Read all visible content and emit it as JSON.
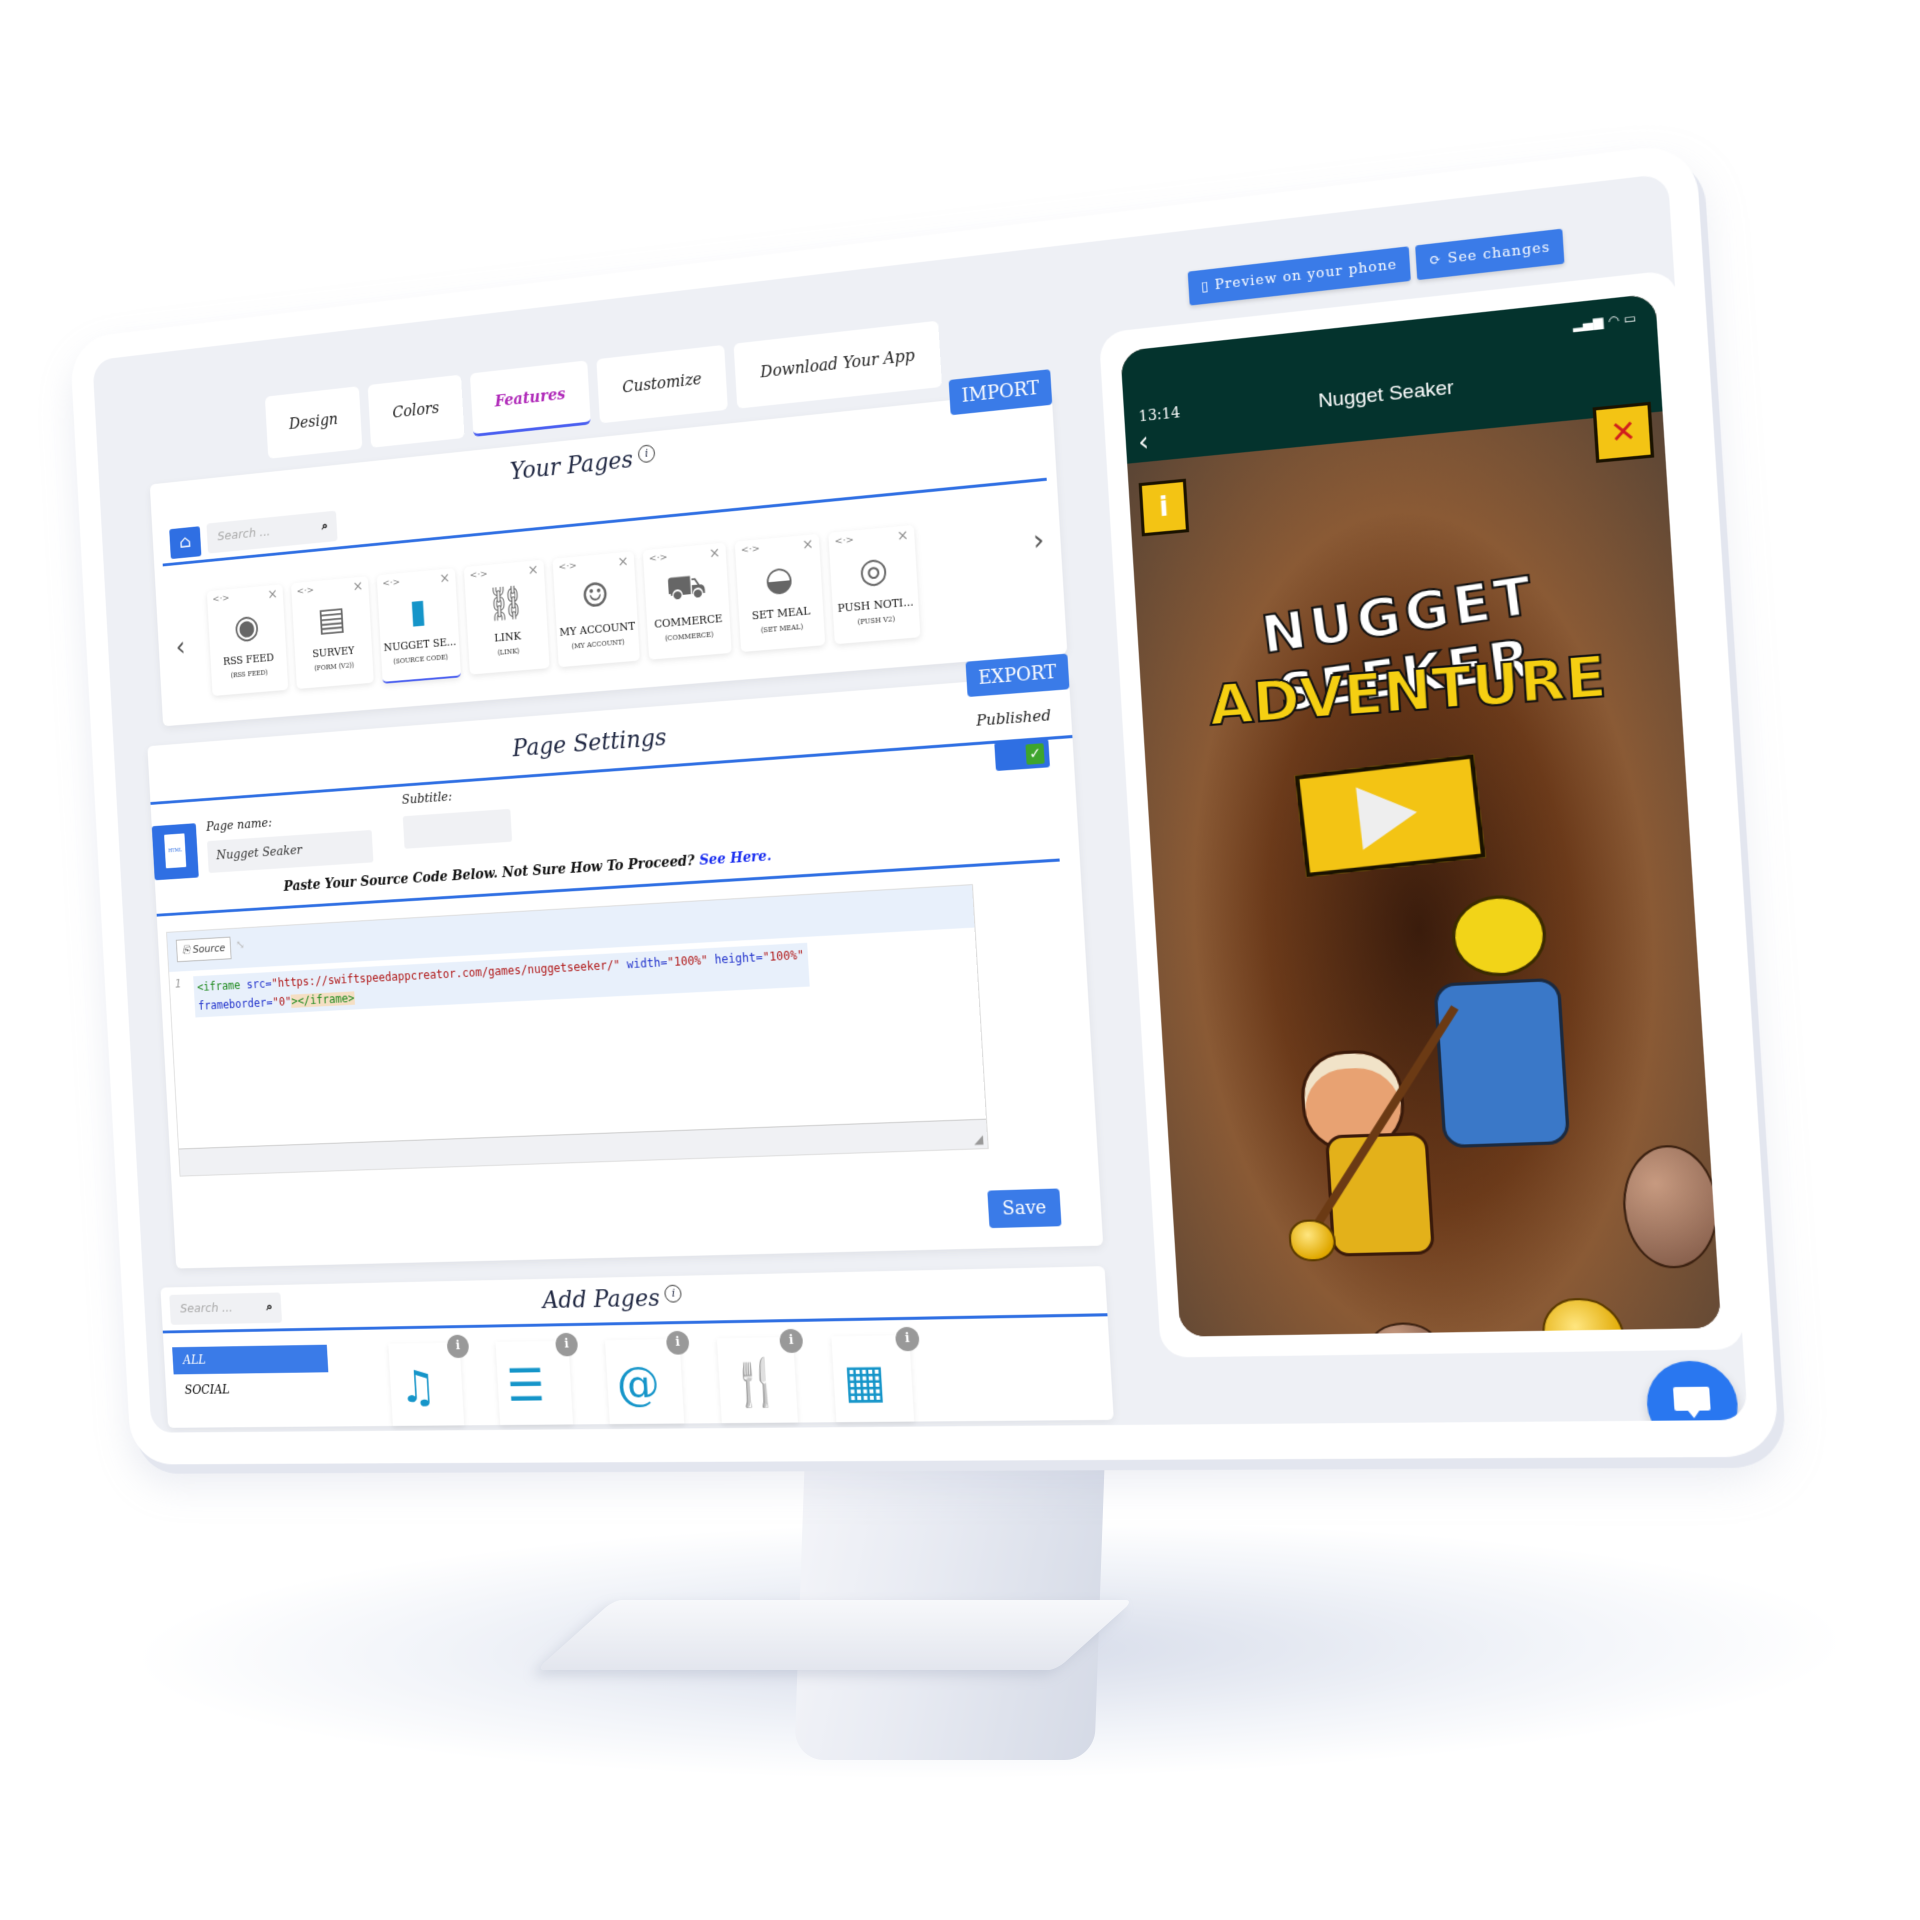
{
  "tabs": [
    {
      "label": "Design"
    },
    {
      "label": "Colors"
    },
    {
      "label": "Features",
      "active": true
    },
    {
      "label": "Customize"
    },
    {
      "label": "Download Your App"
    }
  ],
  "your_pages": {
    "title": "Your Pages",
    "import_label": "IMPORT",
    "search_placeholder": "Search ...",
    "cards": [
      {
        "name": "RSS FEED",
        "type": "(RSS FEED)",
        "icon": "rss-lock-icon"
      },
      {
        "name": "SURVEY",
        "type": "(FORM (V2))",
        "icon": "clipboard-icon"
      },
      {
        "name": "NUGGET SE...",
        "type": "(SOURCE CODE)",
        "icon": "html-file-icon",
        "active": true
      },
      {
        "name": "LINK",
        "type": "(LINK)",
        "icon": "link-lock-icon"
      },
      {
        "name": "MY ACCOUNT",
        "type": "(MY ACCOUNT)",
        "icon": "user-circle-icon"
      },
      {
        "name": "COMMERCE",
        "type": "(COMMERCE)",
        "icon": "cart-icon"
      },
      {
        "name": "SET MEAL",
        "type": "(SET MEAL)",
        "icon": "burger-icon"
      },
      {
        "name": "PUSH NOTI...",
        "type": "(PUSH V2)",
        "icon": "push-icon"
      }
    ]
  },
  "page_settings": {
    "title": "Page Settings",
    "export_label": "EXPORT",
    "published_label": "Published",
    "published": true,
    "page_name_label": "Page name:",
    "page_name_value": "Nugget Seaker",
    "subtitle_label": "Subtitle:",
    "subtitle_value": "",
    "paste_text": "Paste Your Source Code Below. Not Sure How To Proceed?",
    "see_here_label": "See Here."
  },
  "code_editor": {
    "source_label": "Source",
    "line_number": "1",
    "tag_open": "<iframe",
    "attr_src": "src=",
    "val_src": "\"https://swiftspeedappcreator.com/games/nuggetseeker/\"",
    "attr_width": "width=",
    "val_width": "\"100%\"",
    "attr_height": "height=",
    "val_height": "\"100%\"",
    "attr_frameborder": "frameborder=",
    "val_frameborder": "\"0\"",
    "tag_close_bracket": ">",
    "tag_close": "</iframe>"
  },
  "save_label": "Save",
  "add_pages": {
    "title": "Add Pages",
    "search_placeholder": "Search ...",
    "categories": [
      {
        "label": "ALL",
        "active": true
      },
      {
        "label": "SOCIAL"
      }
    ],
    "tiles": [
      {
        "icon": "music-note-icon",
        "glyph": "♫"
      },
      {
        "icon": "list-document-icon",
        "glyph": "☰"
      },
      {
        "icon": "contact-book-icon",
        "glyph": "@"
      },
      {
        "icon": "restaurant-icon",
        "glyph": "🍴"
      },
      {
        "icon": "qr-code-icon",
        "glyph": "▦"
      }
    ],
    "info_glyph": "i"
  },
  "preview": {
    "preview_phone_label": "Preview on your phone",
    "see_changes_label": "See changes",
    "phone": {
      "time": "13:14",
      "title": "Nugget Seaker",
      "game_title_line1": "NUGGET SEEKER",
      "game_title_line2": "ADVENTURE"
    }
  },
  "colors": {
    "accent_blue": "#3a7be8",
    "features_tab": "#b02ab9",
    "phone_header": "#04332d",
    "published_check": "#3ea52d"
  }
}
